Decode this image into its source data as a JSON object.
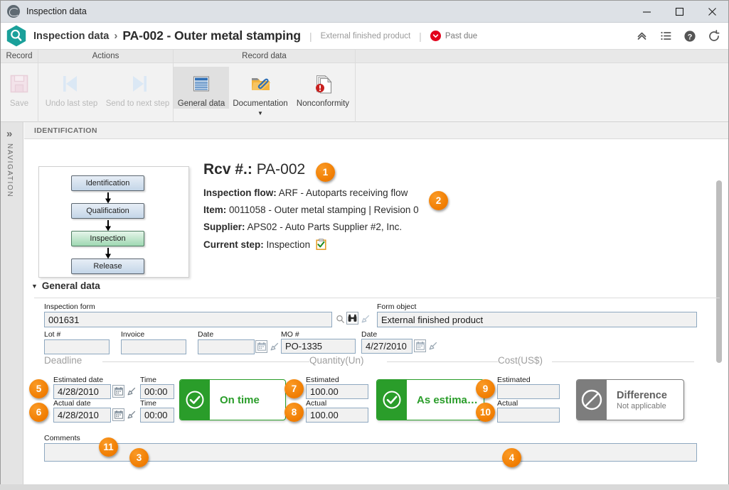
{
  "window": {
    "title": "Inspection data",
    "minimize_label": "Minimize",
    "maximize_label": "Maximize",
    "close_label": "Close"
  },
  "header": {
    "breadcrumb_root": "Inspection data",
    "breadcrumb_sep": "›",
    "title": "PA-002 - Outer metal stamping",
    "divider": "|",
    "subtitle": "External finished product",
    "status_label": "Past due",
    "status_color": "#e2001a",
    "tools": [
      {
        "name": "collapse-ribbon-icon",
        "label": "Collapse"
      },
      {
        "name": "list-menu-icon",
        "label": "Menu"
      },
      {
        "name": "help-icon",
        "label": "Help"
      },
      {
        "name": "refresh-icon",
        "label": "Refresh"
      }
    ]
  },
  "ribbon": {
    "groups": [
      {
        "title": "Record",
        "buttons": [
          {
            "label": "Save",
            "icon": "save-icon",
            "state": "disabled"
          }
        ]
      },
      {
        "title": "Actions",
        "buttons": [
          {
            "label": "Undo last step",
            "icon": "undo-step-icon",
            "state": "disabled"
          },
          {
            "label": "Send to next step",
            "icon": "next-step-icon",
            "state": "disabled"
          }
        ]
      },
      {
        "title": "Record data",
        "buttons": [
          {
            "label": "General data",
            "icon": "general-data-icon",
            "state": "active"
          },
          {
            "label": "Documentation",
            "icon": "documentation-folder-icon",
            "state": "normal",
            "caret": "▼"
          },
          {
            "label": "Nonconformity",
            "icon": "nonconformity-icon",
            "state": "normal"
          }
        ]
      }
    ]
  },
  "navigation": {
    "chevron": "»",
    "label": "NAVIGATION"
  },
  "section": {
    "title": "IDENTIFICATION"
  },
  "flow": {
    "steps": [
      {
        "label": "Identification",
        "current": false
      },
      {
        "label": "Qualification",
        "current": false
      },
      {
        "label": "Inspection",
        "current": true
      },
      {
        "label": "Release",
        "current": false
      }
    ]
  },
  "identification": {
    "rcv_label": "Rcv #.:",
    "rcv_value": "PA-002",
    "rows": [
      {
        "label": "Inspection flow:",
        "value": "ARF - Autoparts receiving flow"
      },
      {
        "label": "Item:",
        "value": "0011058 - Outer metal stamping | Revision 0"
      },
      {
        "label": "Supplier:",
        "value": "APS02 - Auto Parts Supplier #2, Inc."
      },
      {
        "label": "Current step:",
        "value": "Inspection"
      }
    ]
  },
  "general_data": {
    "section_label": "General data",
    "triangle": "▼",
    "inspection_form": {
      "label": "Inspection form",
      "value": "001631"
    },
    "form_object": {
      "label": "Form object",
      "value": "External finished product"
    },
    "lot": {
      "label": "Lot #",
      "value": ""
    },
    "invoice": {
      "label": "Invoice",
      "value": ""
    },
    "date1": {
      "label": "Date",
      "value": ""
    },
    "mo": {
      "label": "MO #",
      "value": "PO-1335"
    },
    "date2": {
      "label": "Date",
      "value": "4/27/2010"
    }
  },
  "deadline": {
    "group_title": "Deadline",
    "estimated_date": {
      "label": "Estimated date",
      "value": "4/28/2010"
    },
    "estimated_time": {
      "label": "Time",
      "value": "00:00"
    },
    "actual_date": {
      "label": "Actual date",
      "value": "4/28/2010"
    },
    "actual_time": {
      "label": "Time",
      "value": "00:00"
    },
    "status": {
      "text": "On time",
      "icon": "check-circle-icon",
      "color": "#2a9d2a"
    }
  },
  "quantity": {
    "group_title": "Quantity(Un)",
    "estimated": {
      "label": "Estimated",
      "value": "100.00"
    },
    "actual": {
      "label": "Actual",
      "value": "100.00"
    },
    "status": {
      "text": "As estima…",
      "icon": "check-circle-icon",
      "color": "#2a9d2a"
    }
  },
  "cost": {
    "group_title": "Cost(US$)",
    "estimated": {
      "label": "Estimated",
      "value": ""
    },
    "actual": {
      "label": "Actual",
      "value": ""
    },
    "status": {
      "text": "Difference",
      "subtext": "Not applicable",
      "icon": "no-entry-icon",
      "color": "#7d7d7d"
    }
  },
  "comments": {
    "label": "Comments",
    "value": ""
  },
  "badges": [
    "1",
    "2",
    "3",
    "4",
    "5",
    "6",
    "7",
    "8",
    "9",
    "10",
    "11"
  ]
}
